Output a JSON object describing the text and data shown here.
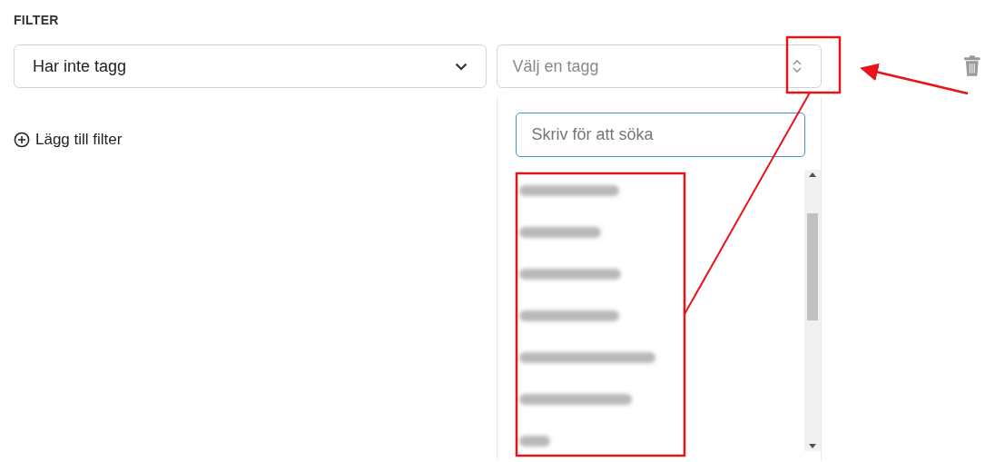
{
  "heading": "FILTER",
  "filter_row": {
    "condition": {
      "value": "Har inte tagg"
    },
    "tag_select": {
      "placeholder": "Välj en tagg",
      "expanded": true
    }
  },
  "dropdown": {
    "search": {
      "placeholder": "Skriv för att söka"
    },
    "options": [
      {
        "kind": "blurred"
      },
      {
        "kind": "blurred"
      },
      {
        "kind": "blurred"
      },
      {
        "kind": "blurred"
      },
      {
        "kind": "blurred"
      },
      {
        "kind": "blurred"
      },
      {
        "kind": "blurred"
      }
    ]
  },
  "add_filter": {
    "label": "Lägg till filter"
  }
}
